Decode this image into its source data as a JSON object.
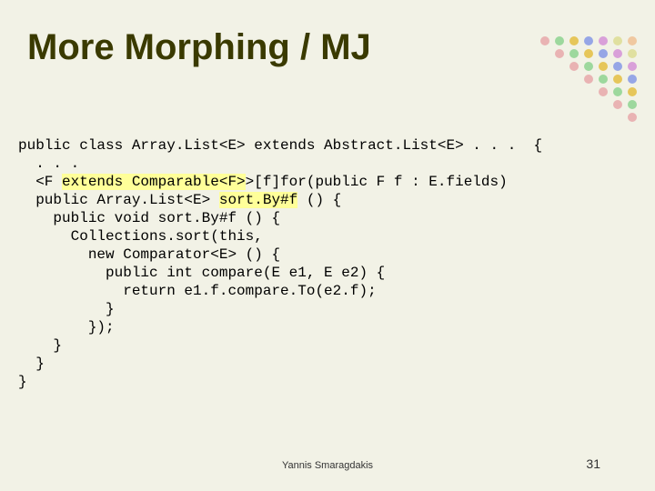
{
  "title": "More Morphing / MJ",
  "code": {
    "l1": "public class Array.List<E> extends Abstract.List<E> . . .  {",
    "l2": "  . . .",
    "l3a": "  <F ",
    "l3b": "extends Comparable<F>",
    "l3c": ">[f]for(public F f : E.fields)",
    "l4a": "  public Array.List<E> ",
    "l4b": "sort.By#f",
    "l4c": " () {",
    "l5": "    public void sort.By#f () {",
    "l6": "      Collections.sort(this,",
    "l7": "        new Comparator<E> () {",
    "l8": "          public int compare(E e1, E e2) {",
    "l9": "            return e1.f.compare.To(e2.f);",
    "l10": "          }",
    "l11": "        });",
    "l12": "    }",
    "l13": "  }",
    "l14": "}"
  },
  "footer": {
    "author": "Yannis Smaragdakis",
    "page": "31"
  },
  "dotColors": {
    "r1": [
      "#e9b3b3",
      "#9dd89d",
      "#e6c65a",
      "#96a6e6",
      "#d9a0d9",
      "#e0e0a0",
      "#f0c8a0"
    ],
    "r2": [
      "#e9b3b3",
      "#9dd89d",
      "#e6c65a",
      "#96a6e6",
      "#d9a0d9",
      "#e0e0a0"
    ],
    "r3": [
      "#e9b3b3",
      "#9dd89d",
      "#e6c65a",
      "#96a6e6",
      "#d9a0d9"
    ],
    "r4": [
      "#e9b3b3",
      "#9dd89d",
      "#e6c65a",
      "#96a6e6"
    ],
    "r5": [
      "#e9b3b3",
      "#9dd89d",
      "#e6c65a"
    ],
    "r6": [
      "#e9b3b3",
      "#9dd89d"
    ],
    "r7": [
      "#e9b3b3"
    ]
  }
}
